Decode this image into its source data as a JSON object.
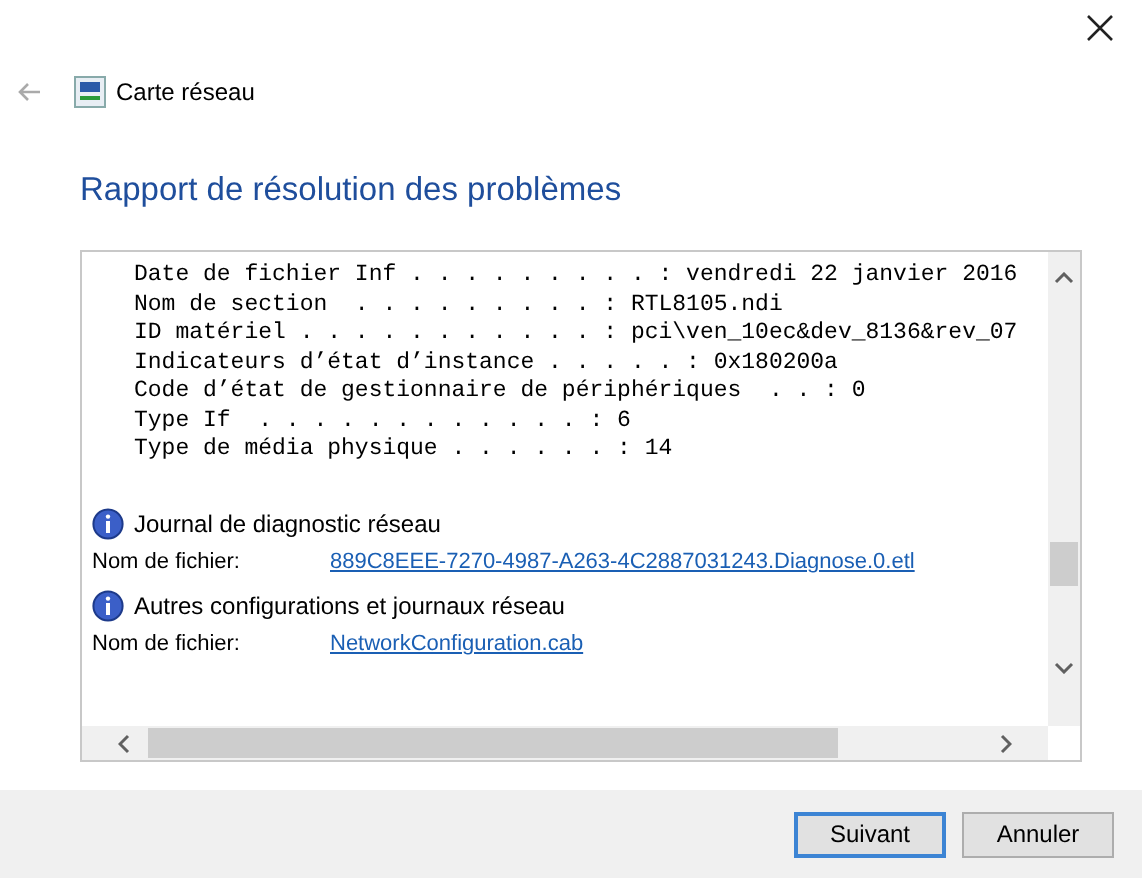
{
  "window": {
    "title": "Carte réseau"
  },
  "heading": "Rapport de résolution des problèmes",
  "report_lines": [
    "Date de fichier Inf . . . . . . . . . : vendredi 22 janvier 2016",
    "Nom de section  . . . . . . . . . : RTL8105.ndi",
    "ID matériel . . . . . . . . . . . : pci\\ven_10ec&dev_8136&rev_07",
    "Indicateurs d’état d’instance . . . . . : 0x180200a",
    "Code d’état de gestionnaire de périphériques  . . : 0",
    "Type If  . . . . . . . . . . . . : 6",
    "Type de média physique . . . . . . : 14"
  ],
  "sections": [
    {
      "title": "Journal de diagnostic réseau",
      "label": "Nom de fichier:",
      "file": "889C8EEE-7270-4987-A263-4C2887031243.Diagnose.0.etl"
    },
    {
      "title": "Autres configurations et journaux réseau",
      "label": "Nom de fichier:",
      "file": "NetworkConfiguration.cab"
    }
  ],
  "buttons": [
    {
      "label": "Suivant",
      "selected": true
    },
    {
      "label": "Annuler",
      "selected": false
    }
  ]
}
